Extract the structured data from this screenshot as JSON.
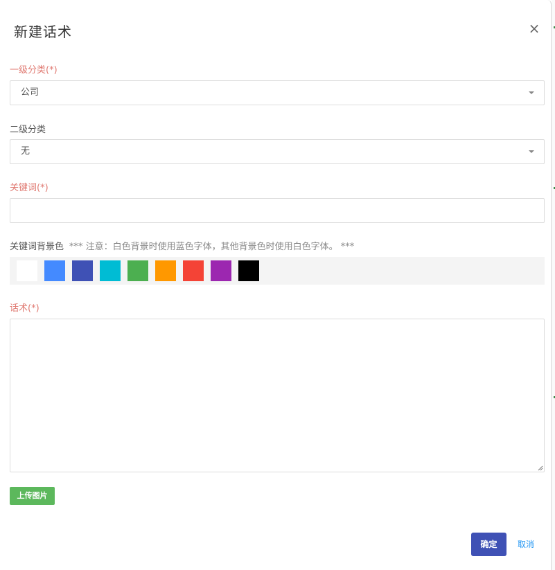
{
  "dialog": {
    "title": "新建话术",
    "close_label": "×"
  },
  "fields": {
    "category1": {
      "label": "一级分类(*)",
      "value": "公司"
    },
    "category2": {
      "label": "二级分类",
      "value": "无"
    },
    "keyword": {
      "label": "关键词(*)",
      "value": ""
    },
    "keyword_bg": {
      "label": "关键词背景色",
      "note": "*** 注意：白色背景时使用蓝色字体，其他背景色时使用白色字体。 ***",
      "colors": [
        "#ffffff",
        "#448aff",
        "#3f51b5",
        "#00bcd4",
        "#4caf50",
        "#ff9800",
        "#f44336",
        "#9c27b0",
        "#000000"
      ]
    },
    "script": {
      "label": "话术(*)",
      "value": ""
    }
  },
  "buttons": {
    "upload_label": "上传图片",
    "confirm_label": "确定",
    "cancel_label": "取消"
  }
}
